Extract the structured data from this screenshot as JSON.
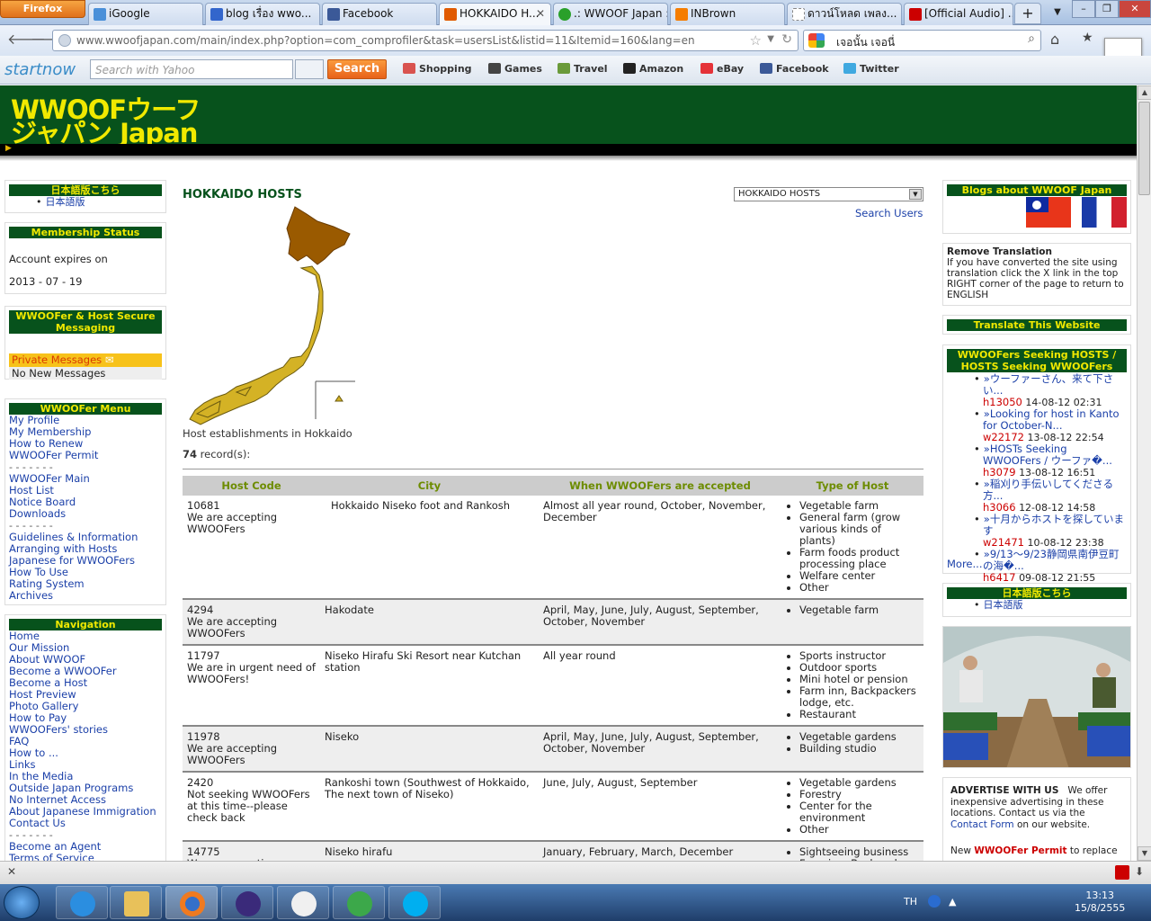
{
  "browser": {
    "app_button": "Firefox",
    "tabs": [
      {
        "label": "iGoogle",
        "color": "#4a90d9"
      },
      {
        "label": "blog เรื่อง wwo...",
        "color": "#3366cc"
      },
      {
        "label": "Facebook",
        "color": "#3b5998"
      },
      {
        "label": "HOKKAIDO H...",
        "color": "#e05a00"
      },
      {
        "label": ".: WWOOF Japan :.",
        "color": "#2aa02a"
      },
      {
        "label": "INBrown",
        "color": "#f57d00"
      },
      {
        "label": "ดาวน์โหลด เพลง...",
        "color": "#aaaaaa"
      },
      {
        "label": "[Official Audio] ...",
        "color": "#cc0000"
      }
    ],
    "url": "www.wwoofjapan.com/main/index.php?option=com_comprofiler&task=usersList&listid=11&Itemid=160&lang=en",
    "search_value": "เจอนั้น เจอนี่"
  },
  "toolbar": {
    "brand": "startnow",
    "search_placeholder": "Search with Yahoo",
    "search_button": "Search",
    "links": [
      "Shopping",
      "Games",
      "Travel",
      "Amazon",
      "eBay",
      "Facebook",
      "Twitter"
    ]
  },
  "site": {
    "logo_line1": "WWOOFウーフ",
    "logo_line2": "ジャパン Japan"
  },
  "left": {
    "lang_header": "日本語版こちら",
    "lang_link": "日本語版",
    "membership_header": "Membership Status",
    "account_label": "Account expires on",
    "account_date": "2013 - 07 - 19",
    "messaging_header": "WWOOFer & Host Secure Messaging",
    "private_messages": "Private Messages",
    "no_messages": "No New Messages",
    "menu_header": "WWOOFer Menu",
    "menu_items": [
      "My Profile",
      "My Membership",
      "How to Renew",
      "WWOOFer Permit",
      "- - - - - - -",
      "WWOOFer Main",
      "Host List",
      "Notice Board",
      "Downloads",
      "- - - - - - -",
      "Guidelines & Information",
      "Arranging with Hosts",
      "Japanese for WWOOFers",
      "How To Use",
      "Rating System",
      "Archives"
    ],
    "nav_header": "Navigation",
    "nav_items": [
      "Home",
      "Our Mission",
      "About WWOOF",
      "Become a WWOOFer",
      "Become a Host",
      "Host Preview",
      "Photo Gallery",
      "How to Pay",
      "WWOOFers' stories",
      "FAQ",
      "How to ...",
      "Links",
      "In the Media",
      "Outside Japan Programs",
      "No Internet Access",
      "About Japanese Immigration",
      "Contact Us",
      "- - - - - - -",
      "Become an Agent",
      "Terms of Service"
    ]
  },
  "main": {
    "title": "HOKKAIDO HOSTS",
    "select_value": "HOKKAIDO HOSTS",
    "search_users": "Search Users",
    "caption": "Host establishments in Hokkaido",
    "record_count": "74",
    "records_label": " record(s):",
    "columns": [
      "Host Code",
      "City",
      "When WWOOFers are accepted",
      "Type of Host"
    ],
    "rows": [
      {
        "code": "10681",
        "status": "We are accepting WWOOFers",
        "city": "Hokkaido Niseko foot and Rankosh",
        "when": "Almost all year round, October, November, December",
        "types": [
          "Vegetable farm",
          "General farm (grow various kinds of plants)",
          "Farm foods product processing place",
          "Welfare center",
          "Other"
        ]
      },
      {
        "code": "4294",
        "status": "We are accepting WWOOFers",
        "city": "Hakodate",
        "when": "April, May, June, July, August, September, October, November",
        "types": [
          "Vegetable farm"
        ]
      },
      {
        "code": "11797",
        "status": "We are in urgent need of WWOOFers!",
        "city": "Niseko Hirafu Ski Resort near Kutchan station",
        "when": "All year round",
        "types": [
          "Sports instructor",
          "Outdoor sports",
          "Mini hotel or pension",
          "Farm inn, Backpackers lodge, etc.",
          "Restaurant"
        ]
      },
      {
        "code": "11978",
        "status": "We are accepting WWOOFers",
        "city": "Niseko",
        "when": "April, May, June, July, August, September, October, November",
        "types": [
          "Vegetable gardens",
          "Building studio"
        ]
      },
      {
        "code": "2420",
        "status": "Not seeking WWOOFers at this time--please check back",
        "city": "Rankoshi town (Southwest of Hokkaido, The next town of Niseko)",
        "when": "June, July, August, September",
        "types": [
          "Vegetable gardens",
          "Forestry",
          "Center for the environment",
          "Other"
        ]
      },
      {
        "code": "14775",
        "status": "We are accepting",
        "city": "Niseko hirafu",
        "when": "January, February, March, December",
        "types": [
          "Sightseeing business",
          "Farm inn, Backpackers"
        ]
      }
    ]
  },
  "right": {
    "blogs_header": "Blogs about WWOOF Japan",
    "remove_title": "Remove Translation",
    "remove_text": "If you have converted the site using translation click the X link in the top RIGHT corner of the page to return to ENGLISH",
    "translate_header": "Translate This Website",
    "seeking_header": "WWOOFers Seeking HOSTS / HOSTS Seeking WWOOFers",
    "posts": [
      {
        "title": "»ウーファーさん、来て下さい...",
        "id": "h13050",
        "time": "14-08-12 02:31"
      },
      {
        "title": "»Looking for host in Kanto for October-N...",
        "id": "w22172",
        "time": "13-08-12 22:54"
      },
      {
        "title": "»HOSTs Seeking WWOOFers / ウーファ�...",
        "id": "h3079",
        "time": "13-08-12 16:51"
      },
      {
        "title": "»稲刈り手伝いしてくださる方...",
        "id": "h3066",
        "time": "12-08-12 14:58"
      },
      {
        "title": "»十月からホストを探しています",
        "id": "w21471",
        "time": "10-08-12 23:38"
      },
      {
        "title": "»9/13〜9/23静岡県南伊豆町の海�...",
        "id": "h6417",
        "time": "09-08-12 21:55"
      }
    ],
    "more": "More...",
    "lang_header": "日本語版こちら",
    "lang_link": "日本語版",
    "advertise_title": "ADVERTISE WITH US",
    "advertise_text": "We offer inexpensive advertising in these locations. Contact us via the",
    "contact_form": "Contact Form",
    "advertise_tail": "on our website.",
    "permit_prefix": "New",
    "permit_link": "WWOOFer Permit",
    "permit_tail": "to replace"
  },
  "taskbar": {
    "lang": "TH",
    "time": "13:13",
    "date": "15/8/2555"
  }
}
